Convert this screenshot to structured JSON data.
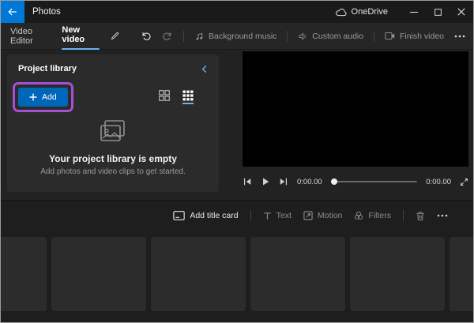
{
  "titlebar": {
    "app_name": "Photos",
    "onedrive_label": "OneDrive"
  },
  "toolbar": {
    "video_editor": "Video Editor",
    "project_name": "New video",
    "background_music": "Background music",
    "custom_audio": "Custom audio",
    "finish_video": "Finish video"
  },
  "library": {
    "title": "Project library",
    "add_label": "Add",
    "empty_title": "Your project library is empty",
    "empty_subtitle": "Add photos and video clips to get started."
  },
  "player": {
    "elapsed": "0:00.00",
    "duration": "0:00.00"
  },
  "timeline": {
    "add_title_card": "Add title card",
    "text": "Text",
    "motion": "Motion",
    "filters": "Filters"
  },
  "colors": {
    "back_button_blue": "#0078d7",
    "add_button_blue": "#0067b8",
    "tab_underline_blue": "#6cb2ec",
    "highlight_purple": "#a64fd6",
    "panel_gray": "#2b2b2b",
    "preview_black": "#000000"
  },
  "icons": [
    "back-arrow",
    "onedrive-cloud",
    "minimize",
    "maximize",
    "close",
    "edit-pencil",
    "undo",
    "redo",
    "music-note",
    "speaker",
    "export-video",
    "more-dots",
    "collapse-chevron",
    "grid-large",
    "grid-small",
    "empty-library-image",
    "previous-frame",
    "play",
    "next-frame",
    "fullscreen-expand",
    "add-title-card",
    "text-tool",
    "motion-tool",
    "filters-tool",
    "trash"
  ]
}
